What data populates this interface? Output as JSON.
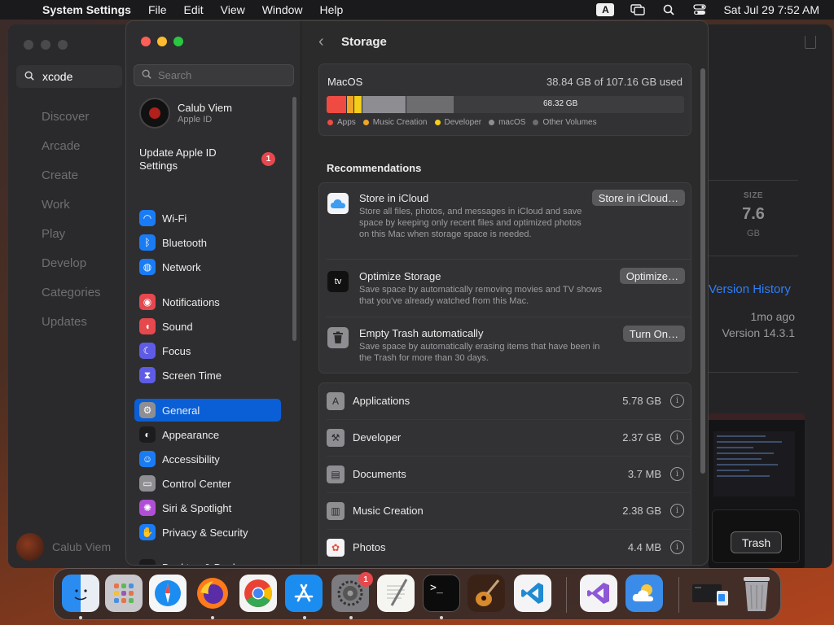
{
  "menubar": {
    "app_name": "System Settings",
    "menus": [
      "File",
      "Edit",
      "View",
      "Window",
      "Help"
    ],
    "input_source": "A",
    "datetime": "Sat Jul 29  7:52 AM"
  },
  "appstore": {
    "search_value": "xcode",
    "nav": [
      "Discover",
      "Arcade",
      "Create",
      "Work",
      "Play",
      "Develop",
      "Categories",
      "Updates"
    ],
    "user_name": "Calub Viem",
    "size_label": "SIZE",
    "size_value": "7.6",
    "size_unit": "GB",
    "version_history": "Version History",
    "updated_ago": "1mo ago",
    "version": "Version 14.3.1"
  },
  "tooltip": "Trash",
  "settings": {
    "search_placeholder": "Search",
    "user": {
      "name": "Calub Viem",
      "subtitle": "Apple ID"
    },
    "update": {
      "label": "Update Apple ID Settings",
      "badge": "1"
    },
    "sidebar_items": [
      {
        "label": "Wi-Fi",
        "icon": "wifi-icon",
        "color": "#1a7cf5"
      },
      {
        "label": "Bluetooth",
        "icon": "bluetooth-icon",
        "color": "#1a7cf5"
      },
      {
        "label": "Network",
        "icon": "globe-icon",
        "color": "#1a7cf5"
      },
      {
        "label": "Notifications",
        "icon": "bell-icon",
        "color": "#e5484d"
      },
      {
        "label": "Sound",
        "icon": "speaker-icon",
        "color": "#e5484d"
      },
      {
        "label": "Focus",
        "icon": "moon-icon",
        "color": "#5e5ce6"
      },
      {
        "label": "Screen Time",
        "icon": "hourglass-icon",
        "color": "#5e5ce6"
      },
      {
        "label": "General",
        "icon": "gear-icon",
        "color": "#8e8e93"
      },
      {
        "label": "Appearance",
        "icon": "appearance-icon",
        "color": "#1c1c1e"
      },
      {
        "label": "Accessibility",
        "icon": "accessibility-icon",
        "color": "#1a7cf5"
      },
      {
        "label": "Control Center",
        "icon": "control-center-icon",
        "color": "#8e8e93"
      },
      {
        "label": "Siri & Spotlight",
        "icon": "siri-icon",
        "color": "#b04fd6"
      },
      {
        "label": "Privacy & Security",
        "icon": "hand-icon",
        "color": "#1a7cf5"
      },
      {
        "label": "Desktop & Dock",
        "icon": "dock-icon",
        "color": "#1c1c1e"
      }
    ],
    "page_title": "Storage",
    "disk": {
      "name": "MacOS",
      "used": "38.84 GB of 107.16 GB used",
      "free": "68.32 GB",
      "segments": [
        {
          "name": "Apps",
          "fraction": 0.054,
          "color": "#ef4b43"
        },
        {
          "name": "Music Creation",
          "fraction": 0.022,
          "color": "#f0a529"
        },
        {
          "name": "Developer",
          "fraction": 0.022,
          "color": "#f4cf19"
        },
        {
          "name": "macOS",
          "fraction": 0.124,
          "color": "#8e8e92"
        },
        {
          "name": "Other Volumes",
          "fraction": 0.133,
          "color": "#6d6d70"
        }
      ],
      "legend": [
        "Apps",
        "Music Creation",
        "Developer",
        "macOS",
        "Other Volumes"
      ]
    },
    "recommendations_title": "Recommendations",
    "recommendations": [
      {
        "title": "Store in iCloud",
        "desc": "Store all files, photos, and messages in iCloud and save space by keeping only recent files and optimized photos on this Mac when storage space is needed.",
        "button": "Store in iCloud…",
        "icon": "icloud-icon"
      },
      {
        "title": "Optimize Storage",
        "desc": "Save space by automatically removing movies and TV shows that you've already watched from this Mac.",
        "button": "Optimize…",
        "icon": "apple-tv-icon",
        "icon_text": "tv"
      },
      {
        "title": "Empty Trash automatically",
        "desc": "Save space by automatically erasing items that have been in the Trash for more than 30 days.",
        "button": "Turn On…",
        "icon": "trash-icon"
      }
    ],
    "categories": [
      {
        "name": "Applications",
        "size": "5.78 GB",
        "icon": "applications-icon"
      },
      {
        "name": "Developer",
        "size": "2.37 GB",
        "icon": "hammer-icon"
      },
      {
        "name": "Documents",
        "size": "3.7 MB",
        "icon": "document-icon"
      },
      {
        "name": "Music Creation",
        "size": "2.38 GB",
        "icon": "piano-icon"
      },
      {
        "name": "Photos",
        "size": "4.4 MB",
        "icon": "photos-icon"
      }
    ]
  },
  "dock": {
    "settings_badge": "1",
    "apps": [
      "Finder",
      "Launchpad",
      "Safari",
      "Firefox",
      "Chrome",
      "App Store",
      "System Settings",
      "TextEdit",
      "Terminal",
      "GarageBand",
      "Visual Studio Code",
      "Visual Studio",
      "Weather",
      "Window Preview",
      "Trash"
    ]
  }
}
